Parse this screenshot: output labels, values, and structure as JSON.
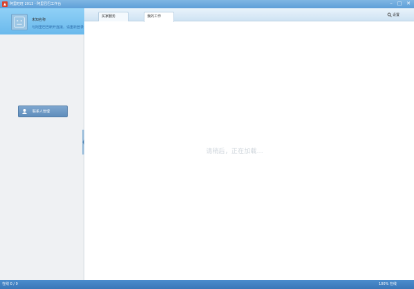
{
  "window": {
    "title": "阿里旺旺 2013 - 阿里巴巴工作台",
    "minimize_glyph": "–",
    "maximize_glyph": "□",
    "close_glyph": "✕"
  },
  "sidebar": {
    "user": {
      "name": "未知名称",
      "status": "与阿里巴巴断开连接，请重新登录"
    },
    "button_label": "联系人管理"
  },
  "tabs": [
    {
      "label": "买家服务"
    },
    {
      "label": "我的工作"
    }
  ],
  "settings": {
    "label": "设置"
  },
  "main": {
    "placeholder": "请稍后，正在加载..."
  },
  "statusbar": {
    "left": "在线 0 / 0",
    "right": "100%   在线"
  },
  "colors": {
    "title_bar": "#6aa9dd",
    "user_panel": "#7cc5f1",
    "sidebar_button": "#6e99c5",
    "status_bar": "#4282c3"
  },
  "icons": [
    "app-logo-icon",
    "avatar-placeholder-icon",
    "contacts-icon",
    "search-icon",
    "collapse-arrow-icon"
  ]
}
